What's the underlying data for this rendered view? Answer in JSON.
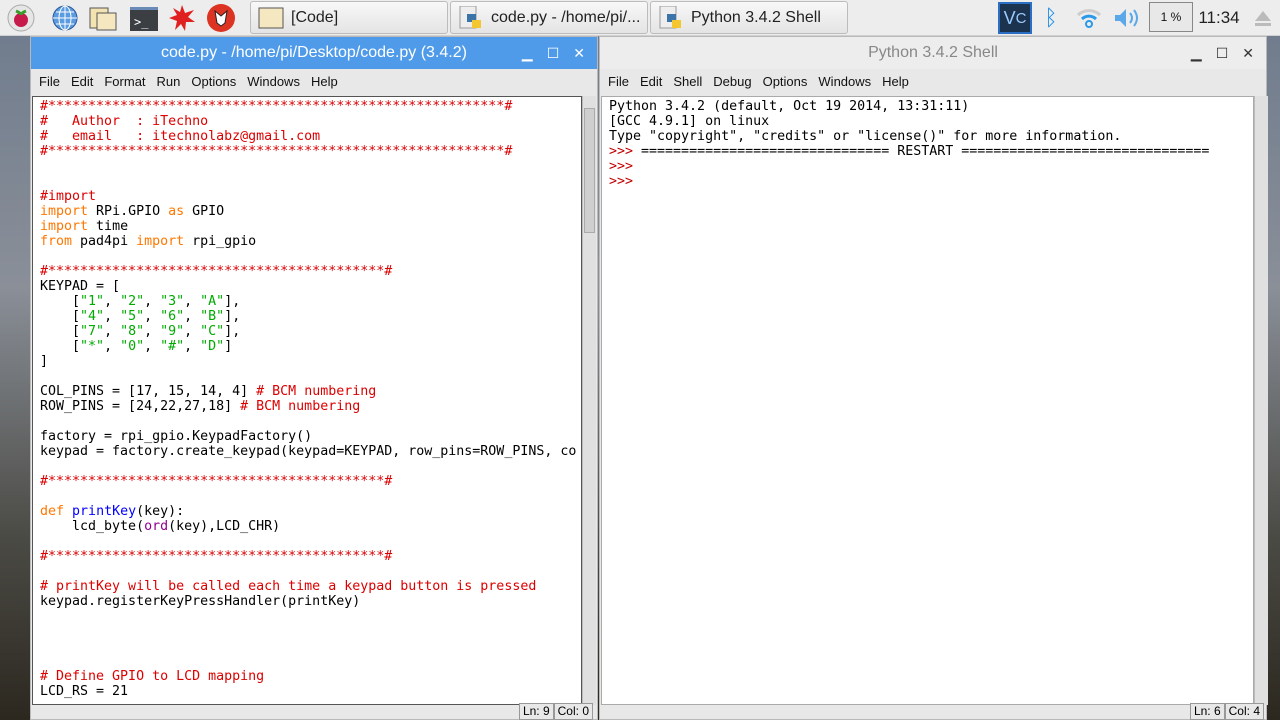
{
  "taskbar": {
    "launchers": [
      "raspberry-menu-icon",
      "web-browser-icon",
      "file-manager-icon",
      "terminal-icon",
      "mathematica-icon",
      "wolfram-icon"
    ],
    "tasks": [
      {
        "label": "[Code]",
        "icon": "folder-icon"
      },
      {
        "label": "code.py - /home/pi/...",
        "icon": "python-file-icon"
      },
      {
        "label": "Python 3.4.2 Shell",
        "icon": "python-file-icon"
      }
    ],
    "tray": {
      "cpu": "1 %",
      "clock": "11:34"
    }
  },
  "editor": {
    "title": "code.py - /home/pi/Desktop/code.py (3.4.2)",
    "menu": [
      "File",
      "Edit",
      "Format",
      "Run",
      "Options",
      "Windows",
      "Help"
    ],
    "status": {
      "ln": "Ln: 9",
      "col": "Col: 0"
    },
    "lines": [
      [
        [
          "#*********************************************************#",
          "c"
        ]
      ],
      [
        [
          "#   Author  : iTechno",
          "c"
        ]
      ],
      [
        [
          "#   email   : itechnolabz@gmail.com",
          "c"
        ]
      ],
      [
        [
          "#*********************************************************#",
          "c"
        ]
      ],
      [],
      [],
      [
        [
          "#import",
          "c"
        ]
      ],
      [
        [
          "import",
          "k"
        ],
        [
          " RPi.GPIO ",
          ""
        ],
        [
          "as",
          "k"
        ],
        [
          " GPIO",
          ""
        ]
      ],
      [
        [
          "import",
          "k"
        ],
        [
          " time",
          ""
        ]
      ],
      [
        [
          "from",
          "k"
        ],
        [
          " pad4pi ",
          ""
        ],
        [
          "import",
          "k"
        ],
        [
          " rpi_gpio",
          ""
        ]
      ],
      [],
      [
        [
          "#******************************************#",
          "c"
        ]
      ],
      [
        [
          "KEYPAD = [",
          ""
        ]
      ],
      [
        [
          "    [",
          ""
        ],
        [
          "\"1\"",
          "s"
        ],
        [
          ", ",
          ""
        ],
        [
          "\"2\"",
          "s"
        ],
        [
          ", ",
          ""
        ],
        [
          "\"3\"",
          "s"
        ],
        [
          ", ",
          ""
        ],
        [
          "\"A\"",
          "s"
        ],
        [
          "],",
          ""
        ]
      ],
      [
        [
          "    [",
          ""
        ],
        [
          "\"4\"",
          "s"
        ],
        [
          ", ",
          ""
        ],
        [
          "\"5\"",
          "s"
        ],
        [
          ", ",
          ""
        ],
        [
          "\"6\"",
          "s"
        ],
        [
          ", ",
          ""
        ],
        [
          "\"B\"",
          "s"
        ],
        [
          "],",
          ""
        ]
      ],
      [
        [
          "    [",
          ""
        ],
        [
          "\"7\"",
          "s"
        ],
        [
          ", ",
          ""
        ],
        [
          "\"8\"",
          "s"
        ],
        [
          ", ",
          ""
        ],
        [
          "\"9\"",
          "s"
        ],
        [
          ", ",
          ""
        ],
        [
          "\"C\"",
          "s"
        ],
        [
          "],",
          ""
        ]
      ],
      [
        [
          "    [",
          ""
        ],
        [
          "\"*\"",
          "s"
        ],
        [
          ", ",
          ""
        ],
        [
          "\"0\"",
          "s"
        ],
        [
          ", ",
          ""
        ],
        [
          "\"#\"",
          "s"
        ],
        [
          ", ",
          ""
        ],
        [
          "\"D\"",
          "s"
        ],
        [
          "]",
          ""
        ]
      ],
      [
        [
          "]",
          ""
        ]
      ],
      [],
      [
        [
          "COL_PINS = [17, 15, 14, 4] ",
          ""
        ],
        [
          "# BCM numbering",
          "c"
        ]
      ],
      [
        [
          "ROW_PINS = [24,22,27,18] ",
          ""
        ],
        [
          "# BCM numbering",
          "c"
        ]
      ],
      [],
      [
        [
          "factory = rpi_gpio.KeypadFactory()",
          ""
        ]
      ],
      [
        [
          "keypad = factory.create_keypad(keypad=KEYPAD, row_pins=ROW_PINS, co",
          ""
        ]
      ],
      [],
      [
        [
          "#******************************************#",
          "c"
        ]
      ],
      [],
      [
        [
          "def",
          "k"
        ],
        [
          " ",
          ""
        ],
        [
          "printKey",
          "d"
        ],
        [
          "(key):",
          ""
        ]
      ],
      [
        [
          "    lcd_byte(",
          ""
        ],
        [
          "ord",
          "b"
        ],
        [
          "(key),LCD_CHR)",
          ""
        ]
      ],
      [],
      [
        [
          "#******************************************#",
          "c"
        ]
      ],
      [],
      [
        [
          "# printKey will be called each time a keypad button is pressed",
          "c"
        ]
      ],
      [
        [
          "keypad.registerKeyPressHandler(printKey)",
          ""
        ]
      ],
      [],
      [],
      [],
      [],
      [
        [
          "# Define GPIO to LCD mapping",
          "c"
        ]
      ],
      [
        [
          "LCD_RS = 21",
          ""
        ]
      ]
    ]
  },
  "shell": {
    "title": "Python 3.4.2 Shell",
    "menu": [
      "File",
      "Edit",
      "Shell",
      "Debug",
      "Options",
      "Windows",
      "Help"
    ],
    "status": {
      "ln": "Ln: 6",
      "col": "Col: 4"
    },
    "lines": [
      [
        [
          "Python 3.4.2 (default, Oct 19 2014, 13:31:11)",
          ""
        ]
      ],
      [
        [
          "[GCC 4.9.1] on linux",
          ""
        ]
      ],
      [
        [
          "Type \"copyright\", \"credits\" or \"license()\" for more information.",
          ""
        ]
      ],
      [
        [
          ">>> ",
          "p"
        ],
        [
          "=============================== RESTART ===============================",
          ""
        ]
      ],
      [
        [
          ">>> ",
          "p"
        ]
      ],
      [
        [
          ">>> ",
          "p"
        ]
      ]
    ]
  },
  "colors": {
    "accent": "#4f9bea",
    "keyword": "#ff7700",
    "comment": "#dd0000",
    "string": "#00aa00",
    "def": "#0000ff",
    "builtin": "#900090"
  }
}
